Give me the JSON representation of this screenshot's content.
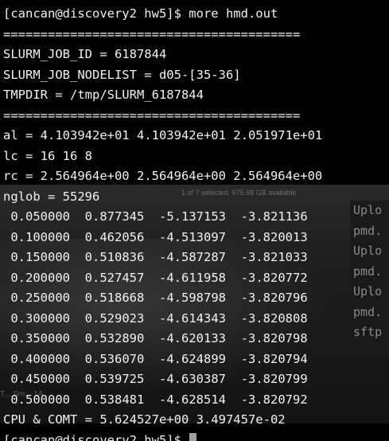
{
  "background_window": {
    "status_text": "1 of 7 selected, 675.68 GB available",
    "side_items": [
      "Uplo",
      "pmd.",
      "Uplo",
      "pmd.",
      "Uplo",
      "pmd.",
      "sftp"
    ],
    "bottom_fragment": "T... Sm... 1A"
  },
  "terminal": {
    "command_line": "[cancan@discovery2 hw5]$ more hmd.out",
    "separator": "========================================",
    "env": [
      "SLURM_JOB_ID = 6187844",
      "SLURM_JOB_NODELIST = d05-[35-36]",
      "TMPDIR = /tmp/SLURM_6187844"
    ],
    "params": [
      "al = 4.103942e+01 4.103942e+01 2.051971e+01",
      "lc = 16 16 8",
      "rc = 2.564964e+00 2.564964e+00 2.564964e+00",
      "nglob = 55296"
    ],
    "rows": [
      [
        "0.050000",
        "0.877345",
        "-5.137153",
        "-3.821136"
      ],
      [
        "0.100000",
        "0.462056",
        "-4.513097",
        "-3.820013"
      ],
      [
        "0.150000",
        "0.510836",
        "-4.587287",
        "-3.821033"
      ],
      [
        "0.200000",
        "0.527457",
        "-4.611958",
        "-3.820772"
      ],
      [
        "0.250000",
        "0.518668",
        "-4.598798",
        "-3.820796"
      ],
      [
        "0.300000",
        "0.529023",
        "-4.614343",
        "-3.820808"
      ],
      [
        "0.350000",
        "0.532890",
        "-4.620133",
        "-3.820798"
      ],
      [
        "0.400000",
        "0.536070",
        "-4.624899",
        "-3.820794"
      ],
      [
        "0.450000",
        "0.539725",
        "-4.630387",
        "-3.820799"
      ],
      [
        "0.500000",
        "0.538481",
        "-4.628514",
        "-3.820792"
      ]
    ],
    "summary": "CPU & COMT = 5.624527e+00 3.497457e-02",
    "final_prompt": "[cancan@discovery2 hw5]$"
  }
}
